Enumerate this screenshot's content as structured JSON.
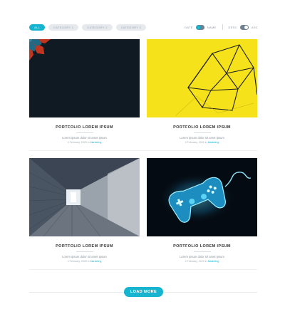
{
  "filters": {
    "categories": [
      {
        "label": "ALL",
        "active": true
      },
      {
        "label": "CATEGORY 1",
        "active": false
      },
      {
        "label": "CATEGORY 2",
        "active": false
      },
      {
        "label": "CATEGORY 3",
        "active": false
      }
    ]
  },
  "sort": {
    "date_label": "DATE",
    "name_label": "NAME",
    "desc_label": "DESC",
    "asc_label": "ASC"
  },
  "cards": [
    {
      "title": "PORTFOLIO LOREM IPSUM",
      "subtitle": "Lorem ipsum dolor sit amet ipsum",
      "date": "4 February, 2020 in",
      "category": "Marketing"
    },
    {
      "title": "PORTFOLIO LOREM IPSUM",
      "subtitle": "Lorem ipsum dolor sit amet ipsum",
      "date": "4 February, 2020 in",
      "category": "Marketing"
    },
    {
      "title": "PORTFOLIO LOREM IPSUM",
      "subtitle": "Lorem ipsum dolor sit amet ipsum",
      "date": "4 February, 2020 in",
      "category": "Marketing"
    },
    {
      "title": "PORTFOLIO LOREM IPSUM",
      "subtitle": "Lorem ipsum dolor sit amet ipsum",
      "date": "4 February, 2020 in",
      "category": "Marketing"
    }
  ],
  "load_more_label": "LOAD MORE",
  "colors": {
    "accent": "#16b4cf",
    "chip_bg": "#e6eaef",
    "yellow": "#f6e21a"
  }
}
